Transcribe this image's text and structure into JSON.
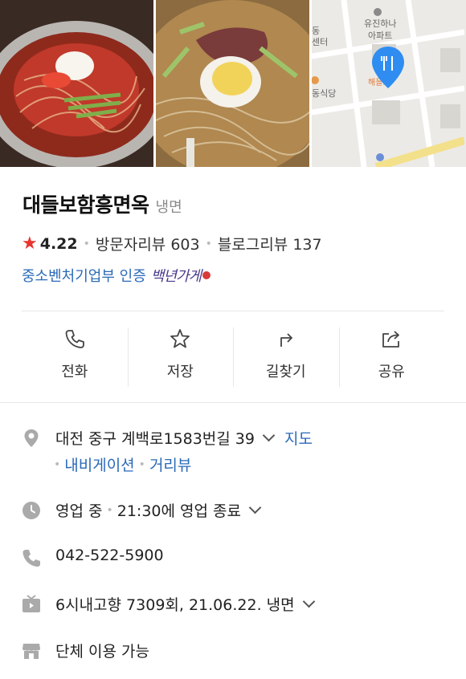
{
  "place": {
    "name": "대들보함흥면옥",
    "category": "냉면",
    "rating": "4.22",
    "visitor_reviews": "방문자리뷰 603",
    "blog_reviews": "블로그리뷰 137",
    "certification": "중소벤처기업부 인증",
    "badge_text": "백년가게"
  },
  "gallery": {
    "map_labels": [
      "유진하나",
      "아파트",
      "동",
      "센터",
      "해들보",
      "동식당"
    ]
  },
  "actions": [
    {
      "label": "전화",
      "icon": "phone-icon"
    },
    {
      "label": "저장",
      "icon": "star-icon"
    },
    {
      "label": "길찾기",
      "icon": "directions-icon"
    },
    {
      "label": "공유",
      "icon": "share-icon"
    }
  ],
  "info": {
    "address": "대전 중구 계백로1583번길 39",
    "map_link": "지도",
    "navigation_link": "내비게이션",
    "street_view_link": "거리뷰",
    "hours_status": "영업 중",
    "hours_detail": "21:30에 영업 종료",
    "phone": "042-522-5900",
    "tv": "6시내고향 7309회, 21.06.22. 냉면",
    "group": "단체 이용 가능"
  },
  "colors": {
    "link": "#2a6ab8",
    "star": "#e8332e",
    "map_pin": "#2f8df2"
  }
}
